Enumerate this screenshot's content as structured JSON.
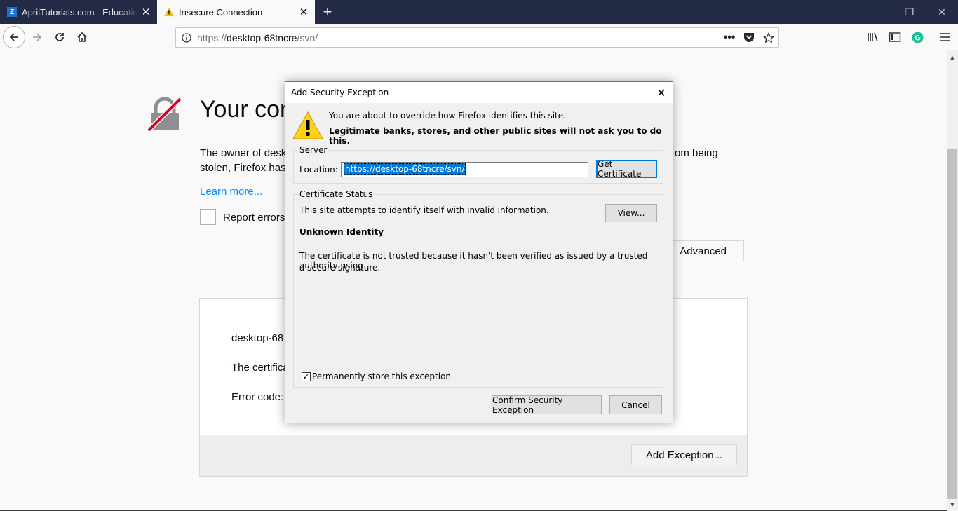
{
  "tabs": [
    {
      "title": "AprilTutorials.com - Educational",
      "favicon": "apriltutorials-favicon"
    },
    {
      "title": "Insecure Connection",
      "favicon": "warning-icon"
    }
  ],
  "urlbar": {
    "prefix": "https://",
    "host": "desktop-68tncre",
    "path": "/svn/"
  },
  "page": {
    "title": "Your con",
    "description": "The owner of desk                                                                                                                      om being stolen, Firefox has",
    "desc_line1_left": "The owner of desk",
    "desc_line1_right": "om being",
    "desc_line2": "stolen, Firefox has",
    "learn_more": "Learn more...",
    "report_errors": "Report errors",
    "advanced_button": "Advanced",
    "panel_host": "desktop-68",
    "panel_cert": "The certifica",
    "panel_error_code": "Error code:",
    "add_exception_button": "Add Exception..."
  },
  "dialog": {
    "title": "Add Security Exception",
    "warning_line1": "You are about to override how Firefox identifies this site.",
    "warning_line2": "Legitimate banks, stores, and other public sites will not ask you to do this.",
    "server_group": "Server",
    "location_label": "Location:",
    "location_value": "https://desktop-68tncre/svn/",
    "get_certificate_button": "Get Certificate",
    "status_group": "Certificate Status",
    "status_line": "This site attempts to identify itself with invalid information.",
    "view_button": "View...",
    "identity_heading": "Unknown Identity",
    "identity_desc1": "The certificate is not trusted because it hasn't been verified as issued by a trusted authority using",
    "identity_desc2": "a secure signature.",
    "permanent_label": "Permanently store this exception",
    "permanent_checked": true,
    "confirm_button": "Confirm Security Exception",
    "cancel_button": "Cancel"
  },
  "colors": {
    "tabbar": "#232a45",
    "accent": "#0078d7",
    "link": "#0a8dff"
  }
}
